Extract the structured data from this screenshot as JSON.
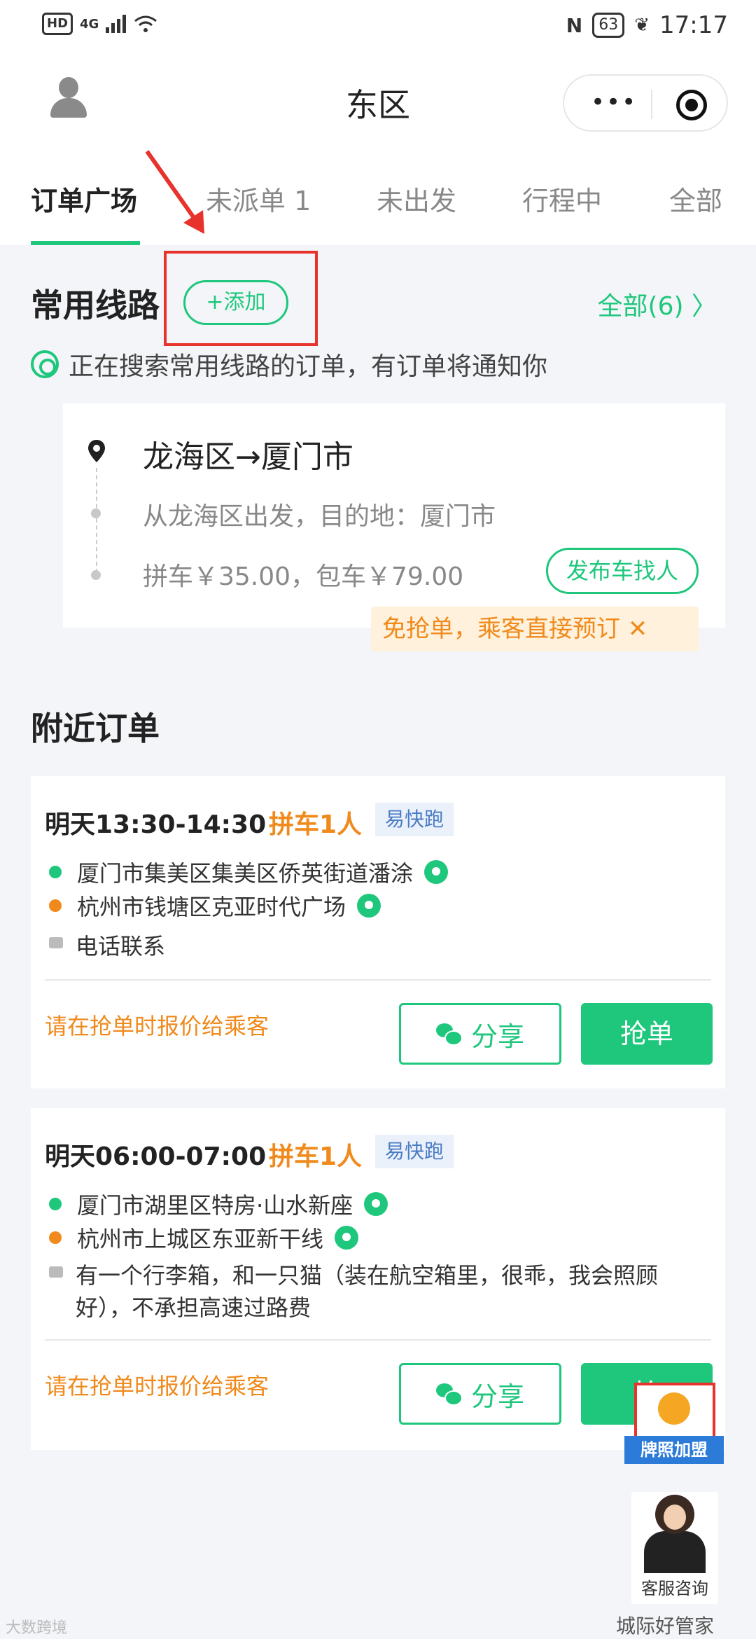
{
  "status_bar": {
    "hd": "HD",
    "network": "4G",
    "battery": "63",
    "time": "17:17"
  },
  "header": {
    "title": "东区",
    "more_label": "•••"
  },
  "tabs": [
    {
      "label": "订单广场"
    },
    {
      "label": "未派单 1"
    },
    {
      "label": "未出发"
    },
    {
      "label": "行程中"
    },
    {
      "label": "全部"
    }
  ],
  "routes": {
    "title": "常用线路",
    "add_label": "+添加",
    "all_label": "全部(6) 〉",
    "notice": "正在搜索常用线路的订单，有订单将通知你",
    "card": {
      "title": "龙海区→厦门市",
      "subtitle": "从龙海区出发，目的地：厦门市",
      "price": "拼车￥35.00，包车￥79.00",
      "publish_label": "发布车找人"
    },
    "promo": "免抢单，乘客直接预订 ✕"
  },
  "nearby": {
    "title": "附近订单",
    "orders": [
      {
        "time": "明天13:30-14:30",
        "type": "拼车1人",
        "tag": "易快跑",
        "from": "厦门市集美区集美区侨英街道潘涂",
        "to": "杭州市钱塘区克亚时代广场",
        "note": "电话联系",
        "quote": "请在抢单时报价给乘客",
        "share_label": "分享",
        "grab_label": "抢单"
      },
      {
        "time": "明天06:00-07:00",
        "type": "拼车1人",
        "tag": "易快跑",
        "from": "厦门市湖里区特房·山水新座",
        "to": "杭州市上城区东亚新干线",
        "note": "有一个行李箱，和一只猫（装在航空箱里，很乖，我会照顾好），不承担高速过路费",
        "quote": "请在抢单时报价给乘客",
        "share_label": "分享",
        "grab_label": "抢"
      }
    ]
  },
  "floating": {
    "license_badge": "牌照加盟",
    "service_label": "客服咨询"
  },
  "watermarks": {
    "left": "大数跨境",
    "right": "城际好管家"
  },
  "colors": {
    "accent": "#1ec77c",
    "orange": "#f08a1c",
    "highlight": "#e8322c",
    "tag_blue": "#4a7bc4"
  }
}
